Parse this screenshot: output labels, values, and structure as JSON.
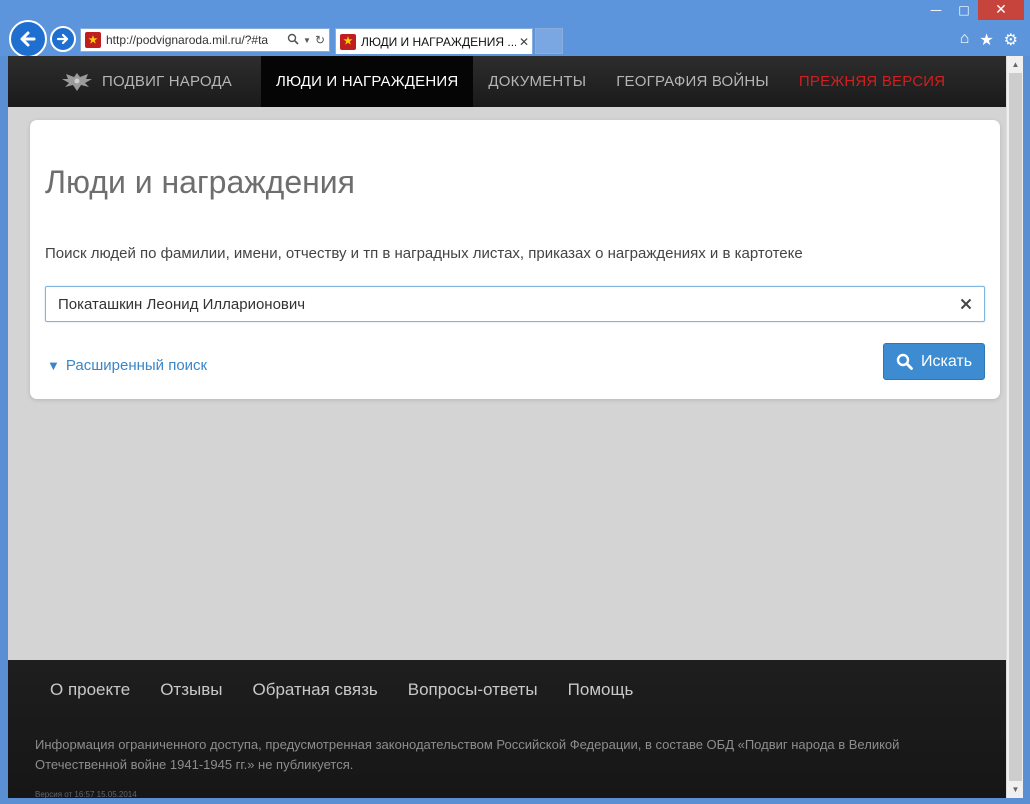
{
  "browser": {
    "address_url": "http://podvignaroda.mil.ru/?#ta",
    "tab_title": "ЛЮДИ И НАГРАЖДЕНИЯ ..."
  },
  "site_nav": {
    "items": [
      {
        "label": "ПОДВИГ НАРОДА",
        "state": "normal"
      },
      {
        "label": "ЛЮДИ И НАГРАЖДЕНИЯ",
        "state": "active"
      },
      {
        "label": "ДОКУМЕНТЫ",
        "state": "normal"
      },
      {
        "label": "ГЕОГРАФИЯ ВОЙНЫ",
        "state": "normal"
      },
      {
        "label": "ПРЕЖНЯЯ ВЕРСИЯ",
        "state": "highlight"
      }
    ]
  },
  "search": {
    "title": "Люди и награждения",
    "description": "Поиск людей по фамилии, имени, отчеству и тп в наградных листах, приказах о награждениях и в картотеке",
    "query_value": "Покаташкин Леонид Илларионович",
    "advanced_label": "Расширенный поиск",
    "submit_label": "Искать"
  },
  "footer": {
    "links": [
      "О проекте",
      "Отзывы",
      "Обратная связь",
      "Вопросы-ответы",
      "Помощь"
    ],
    "info": "Информация ограниченного доступа, предусмотренная законодательством Российской Федерации, в составе ОБД «Подвиг народа в Великой Отечественной войне 1941-1945 гг.» не публикуется.",
    "version": "Версия от 16:57 15.05.2014"
  },
  "colors": {
    "accent": "#3d8bd0",
    "prev_version": "#d21e1e",
    "header_bg": "#1f1f1f",
    "chrome_bg": "#5d95dc"
  }
}
